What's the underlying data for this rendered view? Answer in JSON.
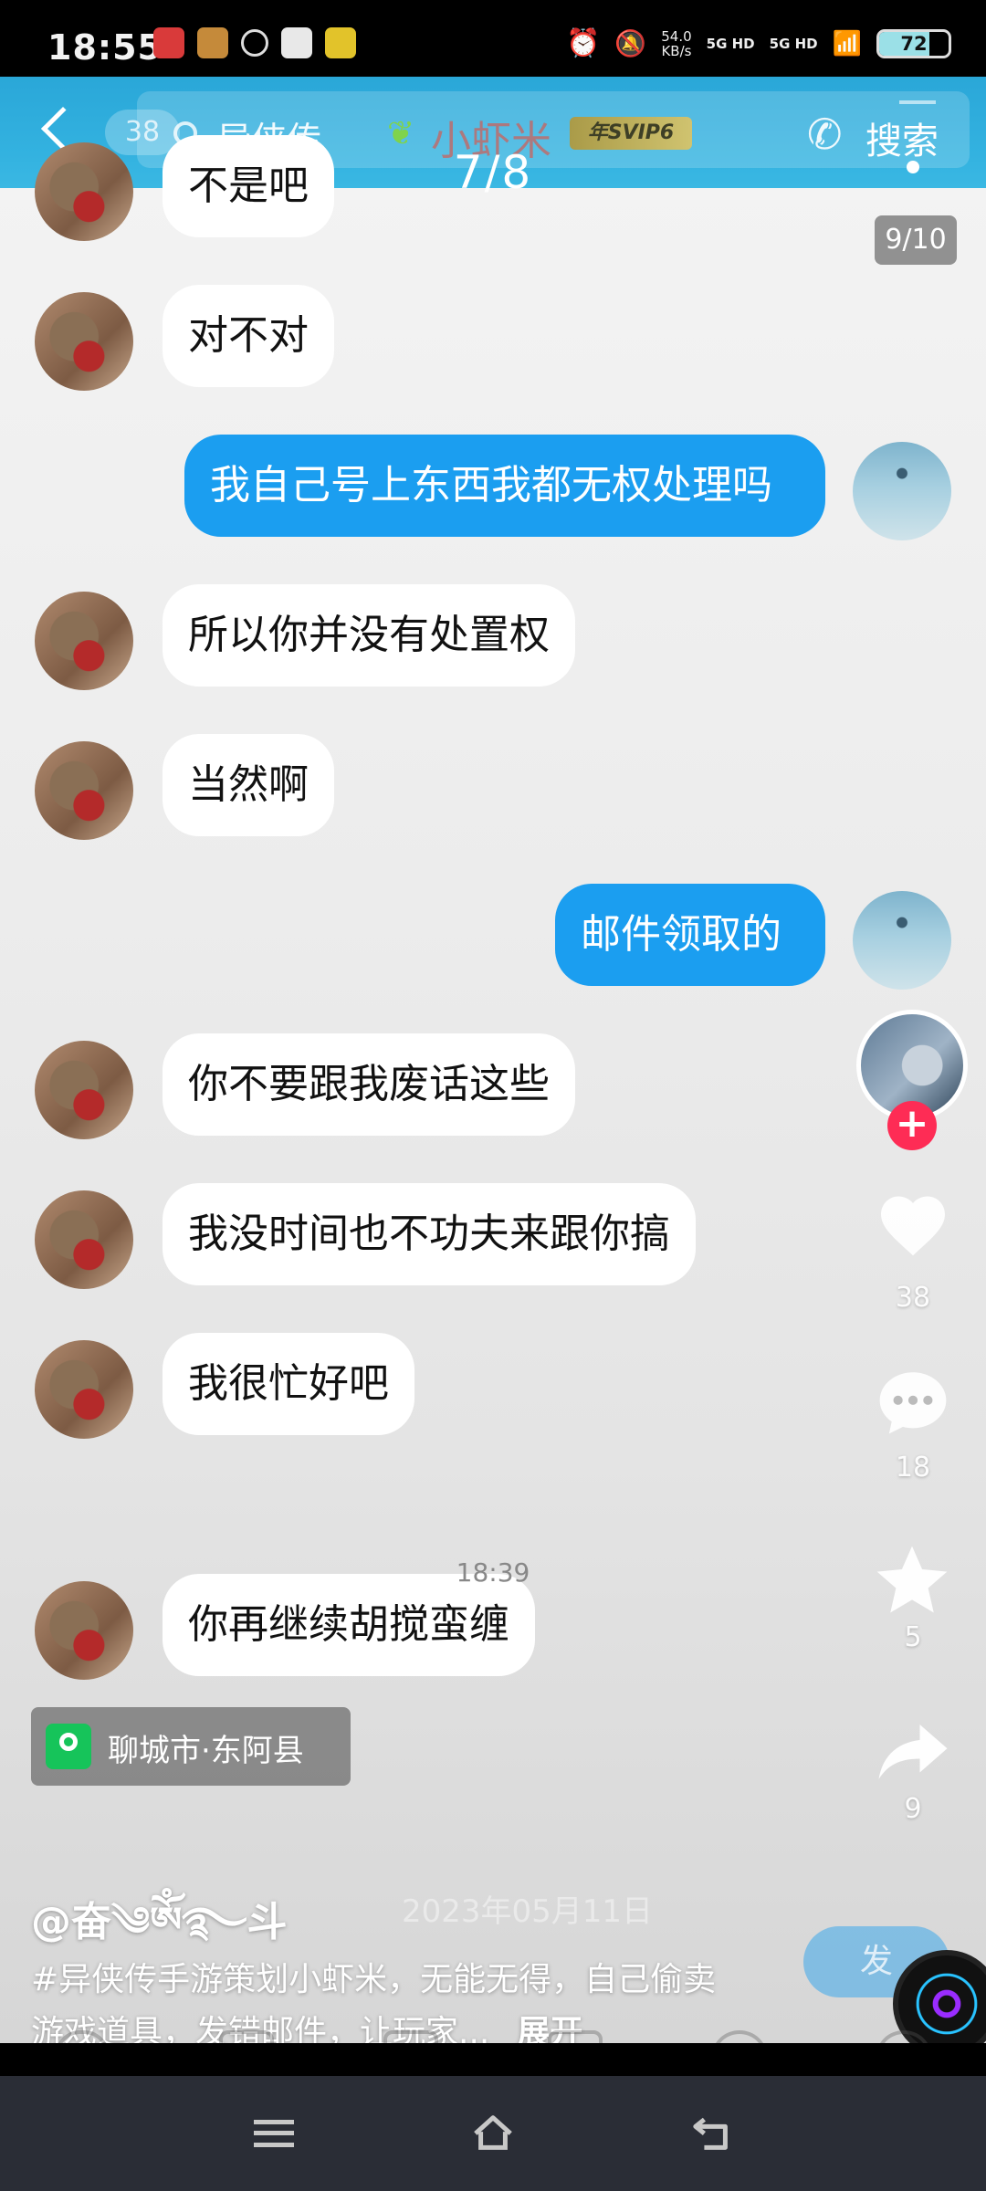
{
  "status_bar": {
    "time": "18:55",
    "net_speed": "54.0",
    "net_unit": "KB/s",
    "signal_1": "5G HD",
    "signal_2": "5G HD",
    "battery": "72",
    "battery_level": 0.72
  },
  "chat_header": {
    "unread_count": "38",
    "search_query": "异侠传",
    "nickname": "小虾米",
    "svip_label": "年SVIP6",
    "search_label": "搜索",
    "page_indicator": "7/8"
  },
  "image_counter": "9/10",
  "messages": [
    {
      "side": "in",
      "text": "不是吧"
    },
    {
      "side": "in",
      "text": "对不对"
    },
    {
      "side": "out",
      "text": "我自己号上东西我都无权处理吗"
    },
    {
      "side": "in",
      "text": "所以你并没有处置权"
    },
    {
      "side": "in",
      "text": "当然啊"
    },
    {
      "side": "out",
      "text": "邮件领取的"
    },
    {
      "side": "in",
      "text": "你不要跟我废话这些"
    },
    {
      "side": "in",
      "text": "我没时间也不功夫来跟你搞"
    },
    {
      "side": "in",
      "text": "我很忙好吧"
    },
    {
      "side": "in",
      "text": "你再继续胡搅蛮缠"
    }
  ],
  "timestamp": "18:39",
  "actions": {
    "likes": "38",
    "comments": "18",
    "favorites": "5",
    "shares": "9"
  },
  "location": "聊城市·东阿县",
  "author": "@奋༄ༀ࿐斗",
  "post_date": "2023年05月11日",
  "caption": "#异侠传手游策划小虾米，无能无得，自己偷卖游戏道具，发错邮件，让玩家...",
  "expand_label": "展开",
  "send_label": "发",
  "colors": {
    "header_blue": "#2aa7d8",
    "outgoing_bubble": "#1b9ef0",
    "follow_red": "#fe2c55",
    "location_green": "#16c45a"
  }
}
